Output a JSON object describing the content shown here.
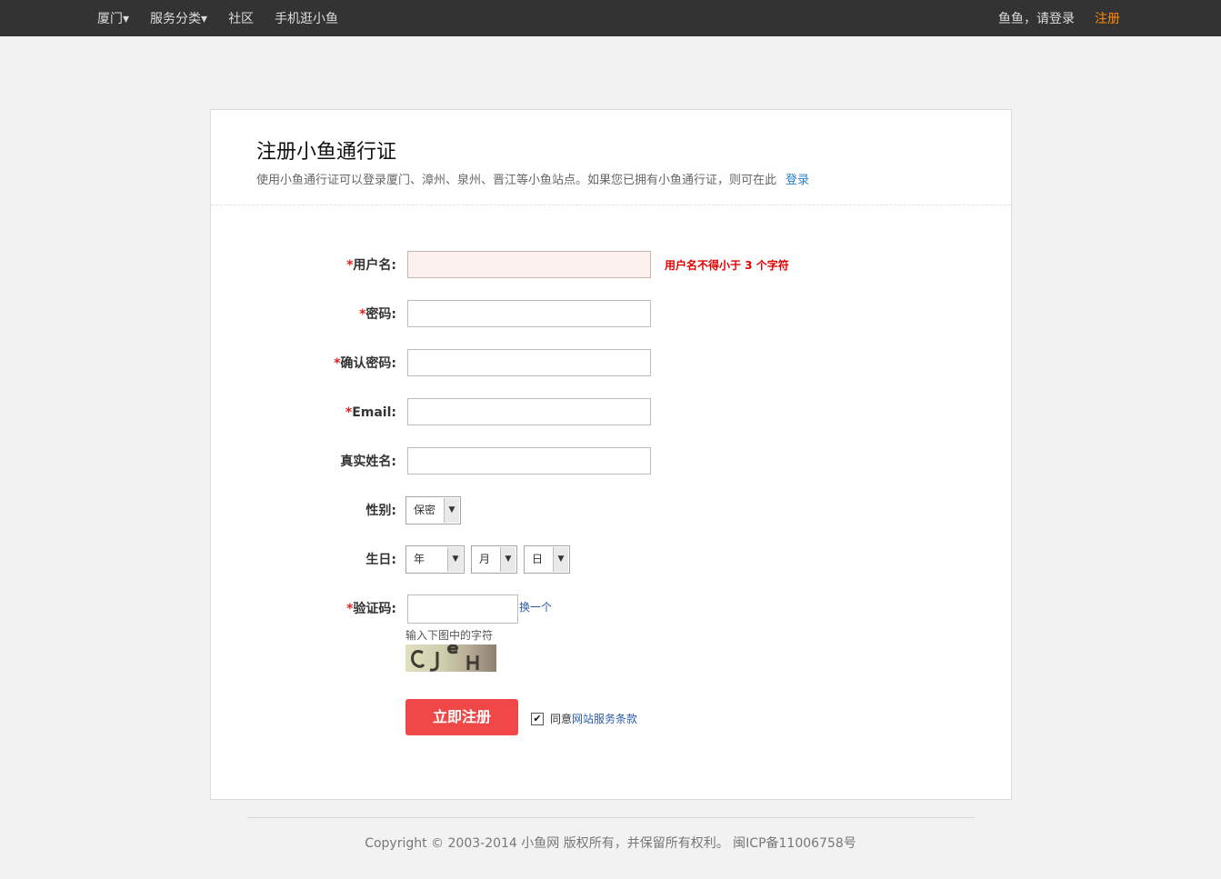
{
  "nav": {
    "city": "厦门▾",
    "services": "服务分类▾",
    "community": "社区",
    "mobile": "手机逛小鱼",
    "login": "鱼鱼，请登录",
    "register": "注册"
  },
  "header": {
    "title": "注册小鱼通行证",
    "desc": "使用小鱼通行证可以登录厦门、漳州、泉州、晋江等小鱼站点。如果您已拥有小鱼通行证，则可在此",
    "login_link": "登录"
  },
  "form": {
    "required_mark": "*",
    "username": {
      "label": "用户名:",
      "value": "",
      "error": "用户名不得小于 3 个字符"
    },
    "password": {
      "label": "密码:",
      "value": ""
    },
    "confirm_password": {
      "label": "确认密码:",
      "value": ""
    },
    "email": {
      "label": "Email:",
      "value": ""
    },
    "realname": {
      "label": "真实姓名:",
      "value": ""
    },
    "gender": {
      "label": "性别:",
      "selected": "保密"
    },
    "birthday": {
      "label": "生日:",
      "year": "年",
      "month": "月",
      "day": "日"
    },
    "captcha": {
      "label": "验证码:",
      "value": "",
      "refresh": "换一个",
      "hint": "输入下图中的字符",
      "image_text": "CJeH"
    },
    "submit": "立即注册",
    "agree": {
      "checked": true,
      "text": "同意",
      "link": "网站服务条款"
    }
  },
  "footer": {
    "copyright": "Copyright © 2003-2014 小鱼网 版权所有，并保留所有权利。 闽ICP备11006758号"
  },
  "colors": {
    "topbar": "#333333",
    "accent_orange": "#ff8a00",
    "button_red": "#f04848",
    "link_blue": "#2a7fc9",
    "error_red": "#e00000"
  }
}
